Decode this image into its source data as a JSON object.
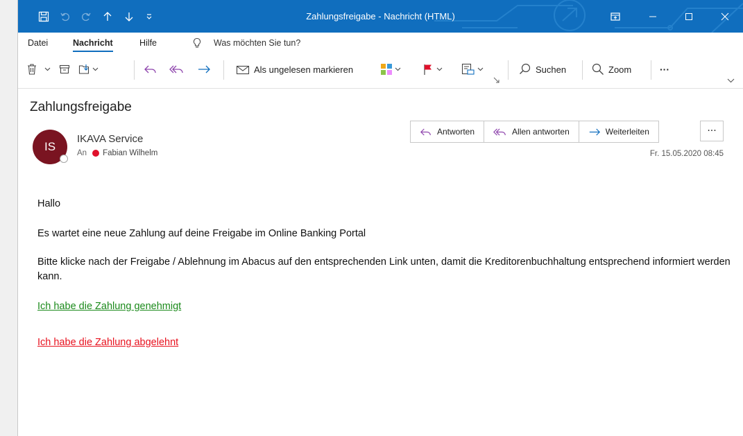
{
  "window": {
    "title": "Zahlungsfreigabe  -  Nachricht (HTML)"
  },
  "menu": {
    "items": [
      "Datei",
      "Nachricht",
      "Hilfe"
    ],
    "active": "Nachricht",
    "search_placeholder": "Was möchten Sie tun?"
  },
  "ribbon": {
    "mark_unread": "Als ungelesen markieren",
    "search": "Suchen",
    "zoom": "Zoom",
    "more": "···"
  },
  "message": {
    "subject": "Zahlungsfreigabe",
    "avatar_initials": "IS",
    "sender": "IKAVA Service",
    "to_label": "An",
    "recipient": "Fabian Wilhelm",
    "date": "Fr. 15.05.2020 08:45",
    "actions": {
      "reply": "Antworten",
      "reply_all": "Allen antworten",
      "forward": "Weiterleiten",
      "more": "···"
    },
    "body": {
      "greeting": "Hallo",
      "line1": "Es wartet eine neue Zahlung auf deine Freigabe im Online Banking Portal",
      "line2": "Bitte klicke nach der Freigabe / Ablehnung im Abacus auf den entsprechenden Link unten, damit die Kreditorenbuchhaltung entsprechend informiert werden kann.",
      "link_approved": "Ich habe die Zahlung genehmigt",
      "link_rejected": "Ich habe die Zahlung abgelehnt"
    }
  },
  "colors": {
    "titlebar": "#106ebe",
    "avatar": "#7a1421",
    "link_approved": "#1b8a1b",
    "link_rejected": "#e8111e",
    "flag": "#e0102b"
  }
}
